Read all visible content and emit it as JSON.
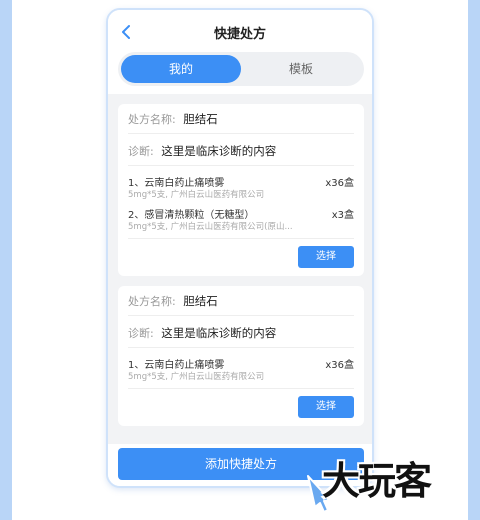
{
  "colors": {
    "accent": "#3c8ff5",
    "side": "#b9d5f7",
    "bg": "#f2f3f5"
  },
  "header": {
    "title": "快捷处方",
    "back_icon": "chevron-left-icon"
  },
  "tabs": [
    {
      "label": "我的",
      "active": true
    },
    {
      "label": "模板",
      "active": false
    }
  ],
  "cards": [
    {
      "name_label": "处方名称:",
      "name_value": "胆结石",
      "diagnosis_label": "诊断:",
      "diagnosis_value": "这里是临床诊断的内容",
      "meds": [
        {
          "name": "1、云南白药止痛喷雾",
          "qty": "x36盒",
          "spec": "5mg*5支, 广州白云山医药有限公司"
        },
        {
          "name": "2、感冒清热颗粒（无糖型）",
          "qty": "x3盒",
          "spec": "5mg*5支, 广州白云山医药有限公司(原山..."
        }
      ],
      "button": "选择"
    },
    {
      "name_label": "处方名称:",
      "name_value": "胆结石",
      "diagnosis_label": "诊断:",
      "diagnosis_value": "这里是临床诊断的内容",
      "meds": [
        {
          "name": "1、云南白药止痛喷雾",
          "qty": "x36盒",
          "spec": "5mg*5支, 广州白云山医药有限公司"
        }
      ],
      "button": "选择"
    }
  ],
  "footer": {
    "add_button": "添加快捷处方"
  },
  "watermark": {
    "text": "大玩客"
  }
}
